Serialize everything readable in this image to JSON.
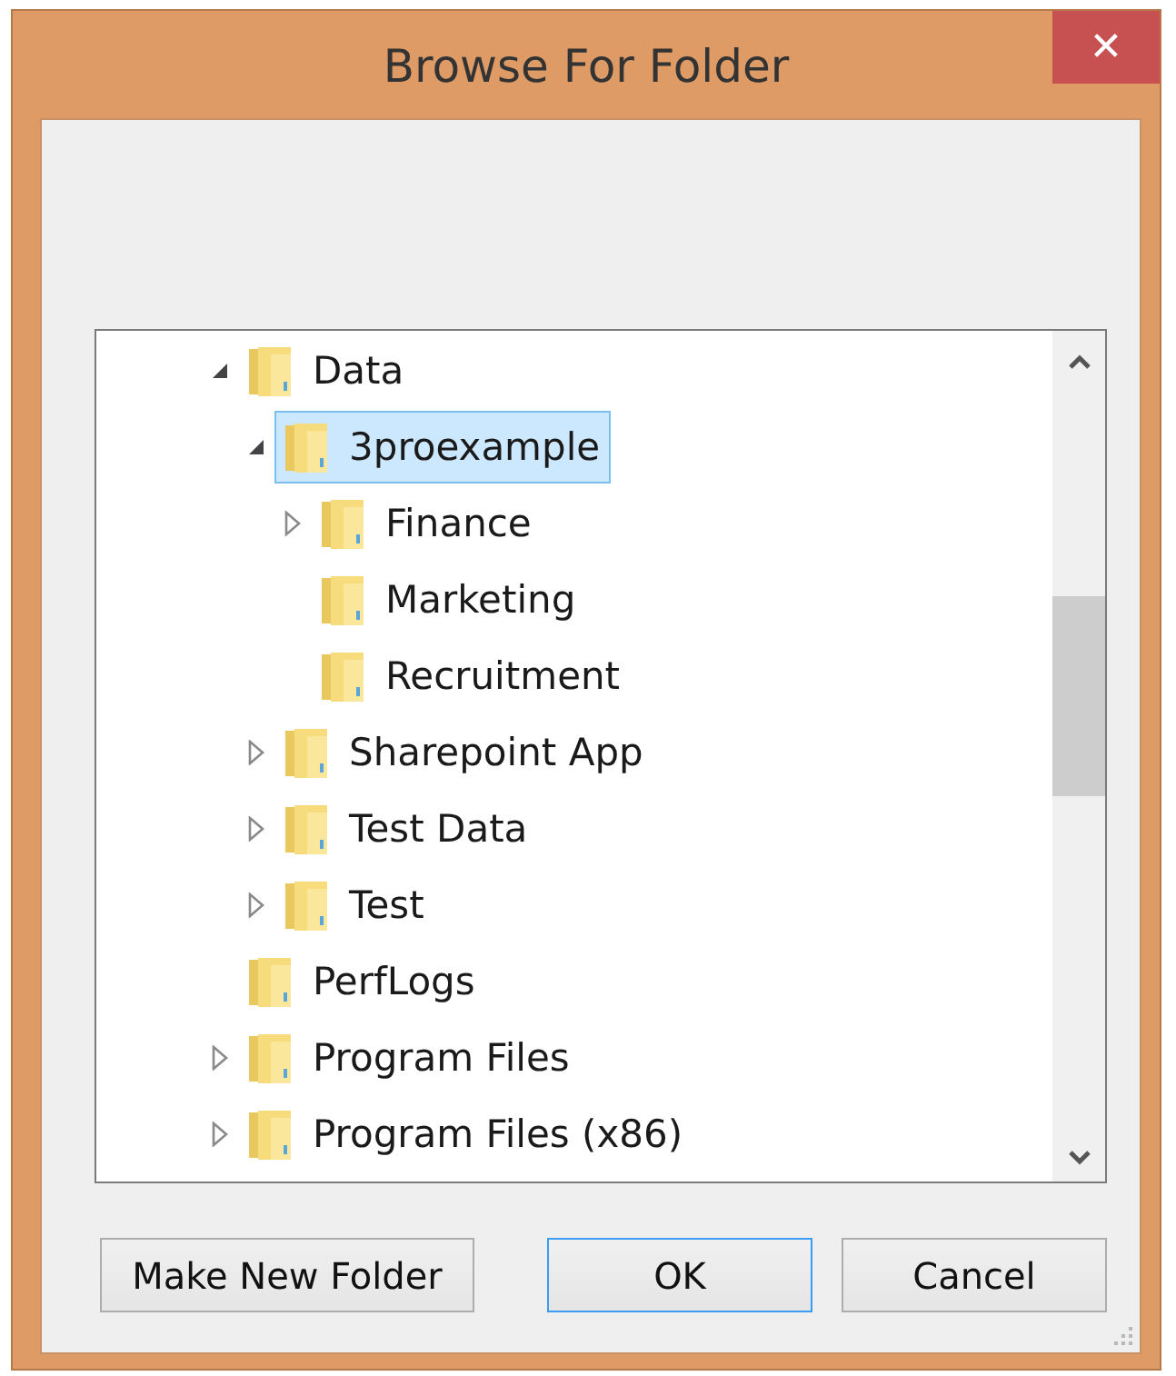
{
  "window": {
    "title": "Browse For Folder",
    "close_label": "✕"
  },
  "tree": [
    {
      "label": "Data",
      "kind": "expandable",
      "expanded": true,
      "selected": false,
      "children": [
        {
          "label": "3proexample",
          "kind": "expandable",
          "expanded": true,
          "selected": true,
          "children": [
            {
              "label": "Finance",
              "kind": "expandable",
              "expanded": false,
              "selected": false
            },
            {
              "label": "Marketing",
              "kind": "leaf",
              "selected": false
            },
            {
              "label": "Recruitment",
              "kind": "leaf",
              "selected": false
            }
          ]
        },
        {
          "label": "Sharepoint App",
          "kind": "expandable",
          "expanded": false,
          "selected": false
        },
        {
          "label": "Test Data",
          "kind": "expandable",
          "expanded": false,
          "selected": false
        },
        {
          "label": "Test",
          "kind": "expandable",
          "expanded": false,
          "selected": false
        }
      ]
    },
    {
      "label": "PerfLogs",
      "kind": "leaf",
      "selected": false
    },
    {
      "label": "Program Files",
      "kind": "expandable",
      "expanded": false,
      "selected": false
    },
    {
      "label": "Program Files (x86)",
      "kind": "expandable",
      "expanded": false,
      "selected": false
    }
  ],
  "buttons": [
    {
      "label": "Make New Folder",
      "default": false
    },
    {
      "label": "OK",
      "default": true
    },
    {
      "label": "Cancel",
      "default": false
    }
  ]
}
